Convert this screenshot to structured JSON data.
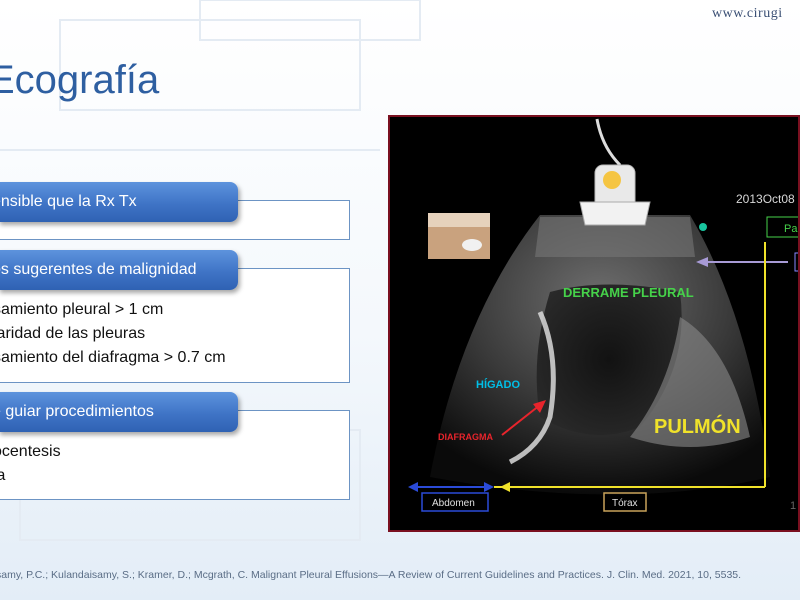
{
  "header": {
    "url": "www.cirugi",
    "title": "Ecografía"
  },
  "sections": [
    {
      "heading": "ensible que la Rx Tx",
      "items": []
    },
    {
      "heading": "os sugerentes de malignidad",
      "items": [
        "samiento pleural > 1 cm",
        "laridad de las pleuras",
        "samiento del diafragma > 0.7 cm"
      ]
    },
    {
      "heading": "e guiar procedimientos",
      "items": [
        "ocentesis",
        "ia"
      ]
    }
  ],
  "ultrasound": {
    "date": "2013Oct08",
    "side_label": "Par",
    "labels": {
      "effusion": "DERRAME PLEURAL",
      "liver": "HÍGADO",
      "diaphragm": "DIAFRAGMA",
      "lung": "PULMÓN",
      "abdomen": "Abdomen",
      "thorax": "Tórax"
    },
    "colors": {
      "effusion": "#46d24a",
      "liver": "#00bfe8",
      "diaphragm": "#e8242c",
      "lung": "#f0e22a",
      "frame": "#7a1020"
    }
  },
  "page_number": "1",
  "footnote": "samy, P.C.; Kulandaisamy, S.; Kramer, D.; Mcgrath, C. Malignant Pleural Effusions—A Review of Current Guidelines and Practices. J. Clin. Med. 2021, 10, 5535."
}
